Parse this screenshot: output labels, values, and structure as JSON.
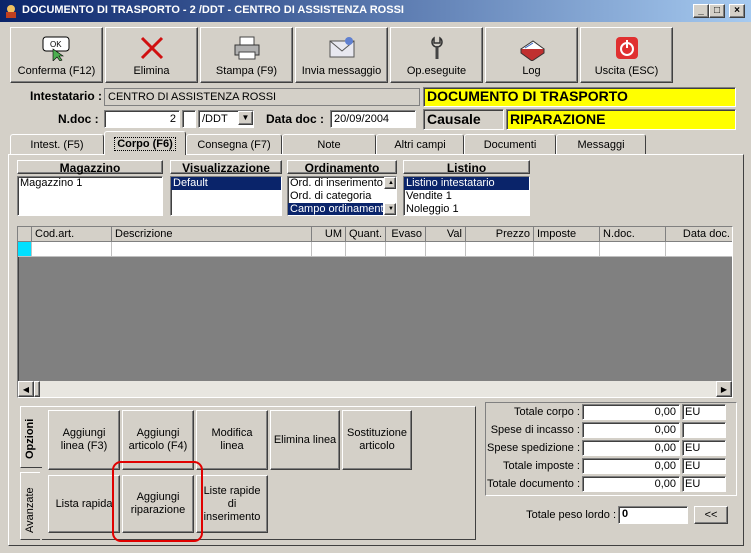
{
  "window": {
    "title": "DOCUMENTO DI TRASPORTO - 2 /DDT - CENTRO DI ASSISTENZA ROSSI",
    "min": "_",
    "max": "□",
    "close": "×"
  },
  "toolbar": {
    "conferma": {
      "label": "Conferma (F12)",
      "icon_text": "OK"
    },
    "elimina": "Elimina",
    "stampa": "Stampa (F9)",
    "invia": "Invia messaggio",
    "opeseguite": "Op.eseguite",
    "log": "Log",
    "uscita": "Uscita (ESC)"
  },
  "header": {
    "intestatario_label": "Intestatario :",
    "intestatario_value": "CENTRO DI ASSISTENZA ROSSI",
    "doc_type": "DOCUMENTO DI TRASPORTO",
    "ndoc_label": "N.doc :",
    "ndoc_value": "2",
    "ndoc_suffix": "/DDT",
    "data_label": "Data doc :",
    "data_value": "20/09/2004",
    "causale_label": "Causale",
    "causale_value": "RIPARAZIONE"
  },
  "tabs": [
    "Intest. (F5)",
    "Corpo (F6)",
    "Consegna (F7)",
    "Note",
    "Altri campi",
    "Documenti",
    "Messaggi"
  ],
  "filters": {
    "magazzino": {
      "title": "Magazzino",
      "items": [
        "Magazzino 1"
      ]
    },
    "visualizzazione": {
      "title": "Visualizzazione",
      "items": [
        "Default"
      ]
    },
    "ordinamento": {
      "title": "Ordinamento",
      "items": [
        "Ord. di inserimento",
        "Ord. di categoria",
        "Campo ordinamento"
      ]
    },
    "listino": {
      "title": "Listino",
      "items": [
        "Listino intestatario",
        "Vendite 1",
        "Noleggio 1"
      ]
    }
  },
  "grid": {
    "columns": [
      "Cod.art.",
      "Descrizione",
      "UM",
      "Quant.",
      "Evaso",
      "Val",
      "Prezzo",
      "Imposte",
      "N.doc.",
      "Data doc."
    ]
  },
  "options": {
    "side_tabs": [
      "Opzioni",
      "Avanzate"
    ],
    "aggiungi_linea": "Aggiungi linea (F3)",
    "aggiungi_articolo": "Aggiungi articolo (F4)",
    "modifica_linea": "Modifica linea",
    "elimina_linea": "Elimina linea",
    "sostituzione": "Sostituzione articolo",
    "lista_rapida": "Lista rapida",
    "aggiungi_riparazione": "Aggiungi riparazione",
    "liste_rapide": "Liste rapide di inserimento"
  },
  "totals": {
    "rows": [
      {
        "label": "Totale corpo :",
        "value": "0,00",
        "cur": "EU"
      },
      {
        "label": "Spese di incasso :",
        "value": "0,00",
        "cur": ""
      },
      {
        "label": "Spese spedizione :",
        "value": "0,00",
        "cur": "EU"
      },
      {
        "label": "Totale imposte :",
        "value": "0,00",
        "cur": "EU"
      },
      {
        "label": "Totale documento :",
        "value": "0,00",
        "cur": "EU"
      }
    ],
    "peso_label": "Totale peso lordo :",
    "peso_value": "0",
    "back_btn": "<<"
  },
  "colors": {
    "highlight": "#e00000",
    "yellow": "#ffff00",
    "selection": "#0a246a"
  }
}
